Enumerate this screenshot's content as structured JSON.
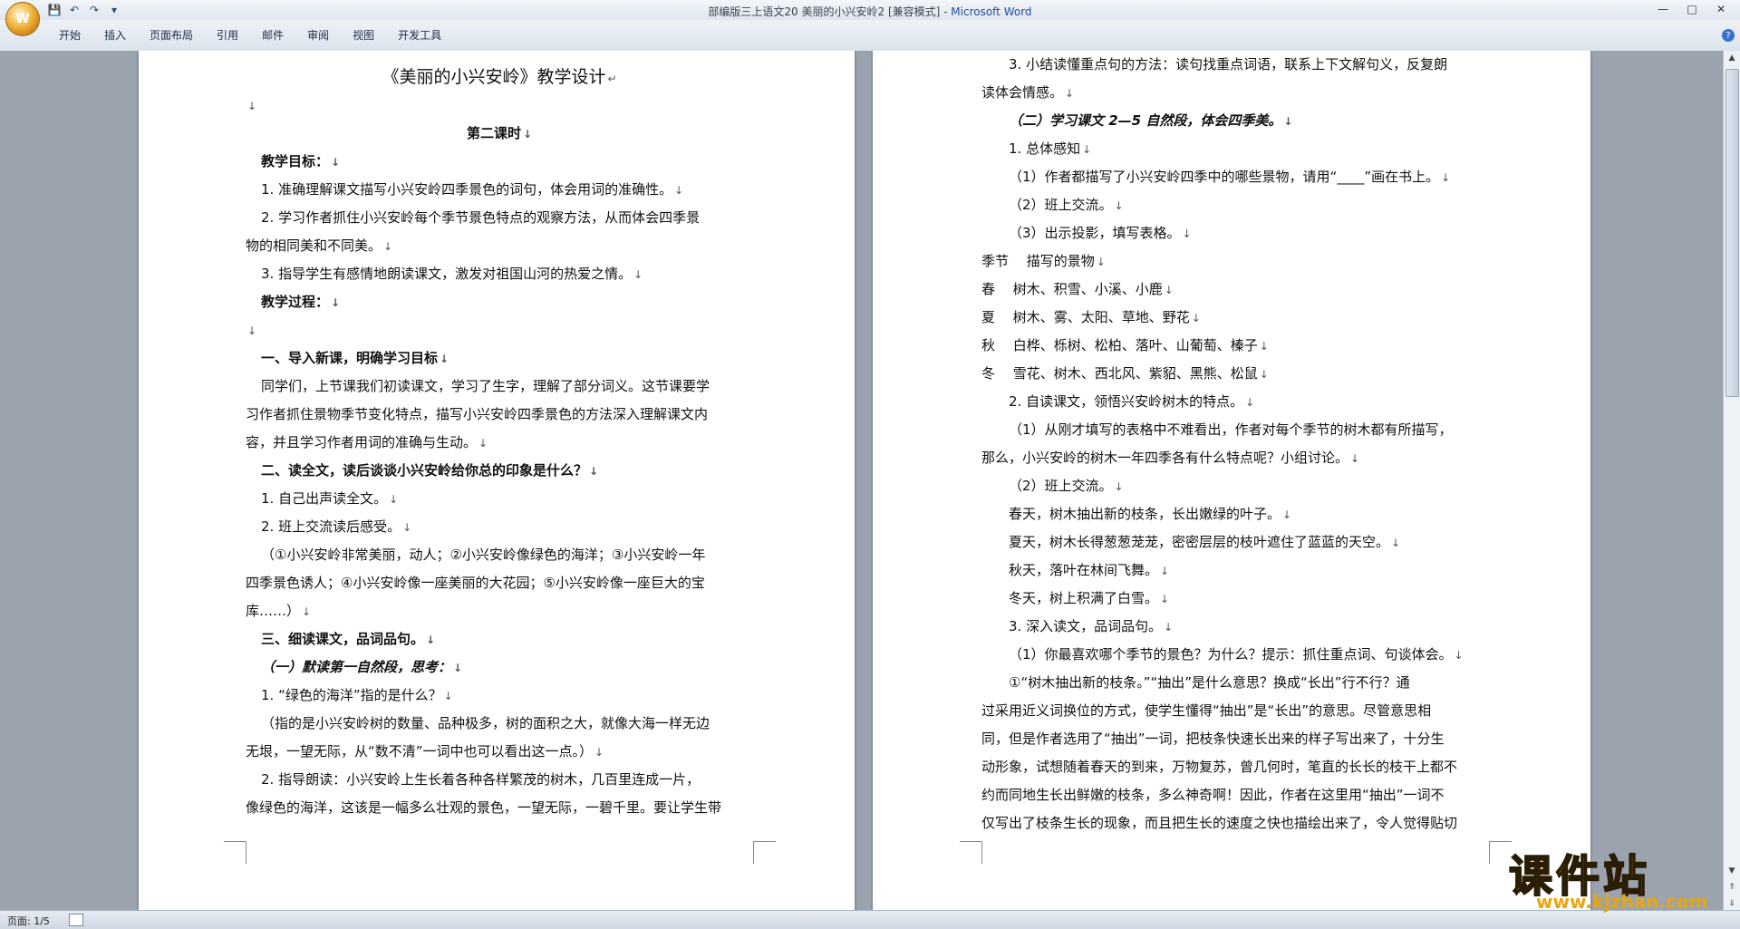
{
  "window": {
    "title_prefix": "部编版三上语文20 美丽的小兴安岭2 [兼容模式] - ",
    "title_app": "Microsoft Word",
    "office_button_label": "W"
  },
  "qat": {
    "save": "💾",
    "undo": "↶",
    "redo": "↷",
    "customize": "▾"
  },
  "ribbon": {
    "tabs": [
      "开始",
      "插入",
      "页面布局",
      "引用",
      "邮件",
      "审阅",
      "视图",
      "开发工具"
    ],
    "help": "?"
  },
  "page1": {
    "lines": [
      {
        "text": "《美丽的小兴安岭》教学设计",
        "style": "center ttl",
        "mark": "↵"
      },
      {
        "text": "",
        "style": "",
        "mark": "↓"
      },
      {
        "text": "第二课时",
        "style": "center b",
        "mark": "↓"
      },
      {
        "text": "教学目标：",
        "style": "i1 b",
        "mark": "↓"
      },
      {
        "text": "1. 准确理解课文描写小兴安岭四季景色的词句，体会用词的准确性。",
        "style": "i1",
        "mark": "↓"
      },
      {
        "text": "2. 学习作者抓住小兴安岭每个季节景色特点的观察方法，从而体会四季景",
        "style": "i1",
        "mark": ""
      },
      {
        "text": "物的相同美和不同美。",
        "style": "",
        "mark": "↓"
      },
      {
        "text": "3. 指导学生有感情地朗读课文，激发对祖国山河的热爱之情。",
        "style": "i1",
        "mark": "↓"
      },
      {
        "text": "教学过程：",
        "style": "i1 b",
        "mark": "↓"
      },
      {
        "text": "",
        "style": "",
        "mark": "↓"
      },
      {
        "text": "一、导入新课，明确学习目标",
        "style": "i1 b",
        "mark": "↓"
      },
      {
        "text": "同学们，上节课我们初读课文，学习了生字，理解了部分词义。这节课要学",
        "style": "i1",
        "mark": ""
      },
      {
        "text": "习作者抓住景物季节变化特点，描写小兴安岭四季景色的方法深入理解课文内",
        "style": "",
        "mark": ""
      },
      {
        "text": "容，并且学习作者用词的准确与生动。",
        "style": "",
        "mark": "↓"
      },
      {
        "text": "二、读全文，读后谈谈小兴安岭给你总的印象是什么？",
        "style": "i1 b",
        "mark": "↓"
      },
      {
        "text": "1. 自己出声读全文。",
        "style": "i1",
        "mark": "↓"
      },
      {
        "text": "2. 班上交流读后感受。",
        "style": "i1",
        "mark": "↓"
      },
      {
        "text": "（①小兴安岭非常美丽，动人；②小兴安岭像绿色的海洋；③小兴安岭一年",
        "style": "i1",
        "mark": ""
      },
      {
        "text": "四季景色诱人；④小兴安岭像一座美丽的大花园；⑤小兴安岭像一座巨大的宝",
        "style": "",
        "mark": ""
      },
      {
        "text": "库……）",
        "style": "",
        "mark": "↓"
      },
      {
        "text": "三、细读课文，品词品句。",
        "style": "i1 b",
        "mark": "↓"
      },
      {
        "text": "（一）默读第一自然段，思考：",
        "style": "i1 bi",
        "mark": "↓"
      },
      {
        "text": "1. “绿色的海洋”指的是什么？",
        "style": "i1",
        "mark": "↓"
      },
      {
        "text": "（指的是小兴安岭树的数量、品种极多，树的面积之大，就像大海一样无边",
        "style": "i1",
        "mark": ""
      },
      {
        "text": "无垠，一望无际，从“数不清”一词中也可以看出这一点。）",
        "style": "",
        "mark": "↓"
      },
      {
        "text": "2. 指导朗读：小兴安岭上生长着各种各样繁茂的树木，几百里连成一片，",
        "style": "i1",
        "mark": ""
      },
      {
        "text": "像绿色的海洋，这该是一幅多么壮观的景色，一望无际，一碧千里。要让学生带",
        "style": "",
        "mark": ""
      }
    ]
  },
  "page2": {
    "lines": [
      {
        "text": "3. 小结读懂重点句的方法：读句找重点词语，联系上下文解句义，反复朗",
        "style": "i2",
        "mark": ""
      },
      {
        "text": "读体会情感。",
        "style": "",
        "mark": "↓"
      },
      {
        "text": "（二）学习课文 2—5 自然段，体会四季美。",
        "style": "i2 bi",
        "mark": "↓"
      },
      {
        "text": "1. 总体感知",
        "style": "i2",
        "mark": "↓"
      },
      {
        "text": "（1）作者都描写了小兴安岭四季中的哪些景物，请用“____”画在书上。",
        "style": "i2",
        "mark": "↓"
      },
      {
        "text": "（2）班上交流。",
        "style": "i2",
        "mark": "↓"
      },
      {
        "text": "（3）出示投影，填写表格。",
        "style": "i2",
        "mark": "↓"
      },
      {
        "text": "季节　 描写的景物",
        "style": "",
        "mark": "↓"
      },
      {
        "text": "春　 树木、积雪、小溪、小鹿",
        "style": "",
        "mark": "↓"
      },
      {
        "text": "夏　 树木、雾、太阳、草地、野花",
        "style": "",
        "mark": "↓"
      },
      {
        "text": "秋　 白桦、栎树、松柏、落叶、山葡萄、榛子",
        "style": "",
        "mark": "↓"
      },
      {
        "text": "冬　 雪花、树木、西北风、紫貂、黑熊、松鼠",
        "style": "",
        "mark": "↓"
      },
      {
        "text": "2. 自读课文，领悟兴安岭树木的特点。",
        "style": "i2",
        "mark": "↓"
      },
      {
        "text": "（1）从刚才填写的表格中不难看出，作者对每个季节的树木都有所描写，",
        "style": "i2",
        "mark": ""
      },
      {
        "text": "那么，小兴安岭的树木一年四季各有什么特点呢？小组讨论。",
        "style": "",
        "mark": "↓"
      },
      {
        "text": "（2）班上交流。",
        "style": "i2",
        "mark": "↓"
      },
      {
        "text": "春天，树木抽出新的枝条，长出嫩绿的叶子。",
        "style": "i2",
        "mark": "↓"
      },
      {
        "text": "夏天，树木长得葱葱茏茏，密密层层的枝叶遮住了蓝蓝的天空。",
        "style": "i2",
        "mark": "↓"
      },
      {
        "text": "秋天，落叶在林间飞舞。",
        "style": "i2",
        "mark": "↓"
      },
      {
        "text": "冬天，树上积满了白雪。",
        "style": "i2",
        "mark": "↓"
      },
      {
        "text": "3. 深入读文，品词品句。",
        "style": "i2",
        "mark": "↓"
      },
      {
        "text": "（1）你最喜欢哪个季节的景色？为什么？提示：抓住重点词、句谈体会。",
        "style": "i2",
        "mark": "↓"
      },
      {
        "text": "①“树木抽出新的枝条。”“抽出”是什么意思？换成“长出”行不行？通",
        "style": "i2",
        "mark": ""
      },
      {
        "text": "过采用近义词换位的方式，使学生懂得“抽出”是“长出”的意思。尽管意思相",
        "style": "",
        "mark": ""
      },
      {
        "text": "同，但是作者选用了“抽出”一词，把枝条快速长出来的样子写出来了，十分生",
        "style": "",
        "mark": ""
      },
      {
        "text": "动形象，试想随着春天的到来，万物复苏，曾几何时，笔直的长长的枝干上都不",
        "style": "",
        "mark": ""
      },
      {
        "text": "约而同地生长出鲜嫩的枝条，多么神奇啊！因此，作者在这里用“抽出”一词不",
        "style": "",
        "mark": ""
      },
      {
        "text": "仅写出了枝条生长的现象，而且把生长的速度之快也描绘出来了，令人觉得贴切",
        "style": "",
        "mark": ""
      }
    ]
  },
  "status": {
    "page_info": "页面: 1/5"
  },
  "watermark": {
    "main": "课件站",
    "url": "www.kjzhan.com"
  }
}
